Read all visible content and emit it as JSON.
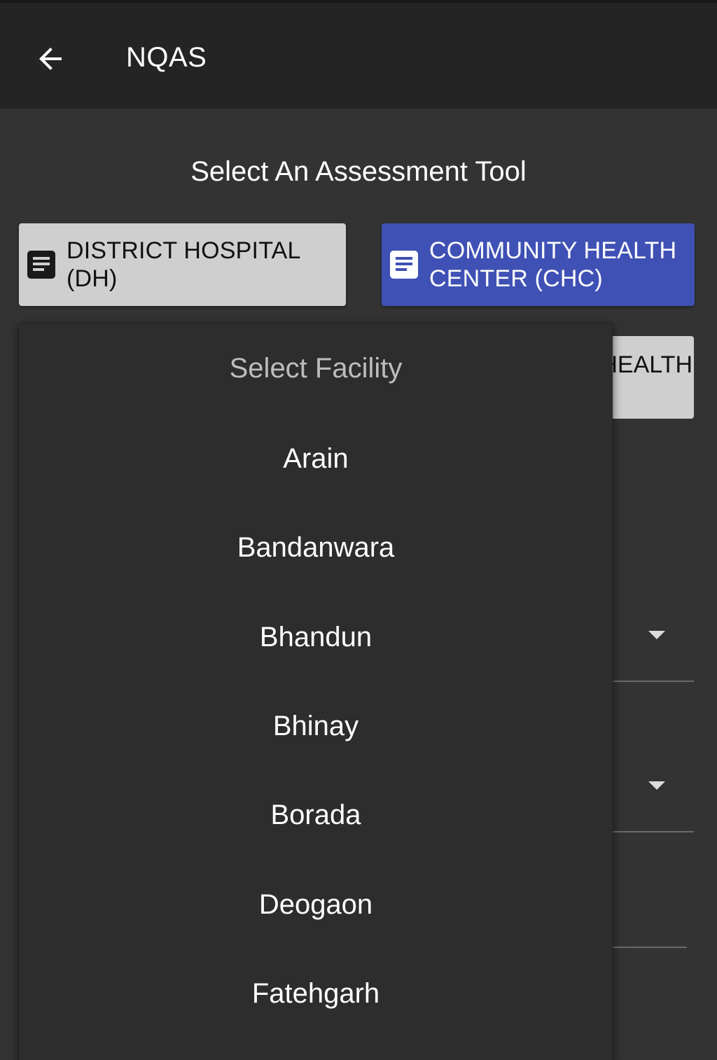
{
  "appbar": {
    "title": "NQAS",
    "back_icon": "arrow-left-icon"
  },
  "main": {
    "heading": "Select An Assessment Tool",
    "tools": [
      {
        "label": "DISTRICT HOSPITAL (DH)",
        "icon": "document-icon",
        "selected": false
      },
      {
        "label_line1": "COMMUNITY HEALTH",
        "label_line2": "CENTER (CHC)",
        "icon": "document-icon",
        "selected": true
      }
    ],
    "background_chip_text": "HEALTH"
  },
  "dropdown": {
    "header": "Select Facility",
    "options": [
      "Arain",
      "Bandanwara",
      "Bhandun",
      "Bhinay",
      "Borada",
      "Deogaon",
      "Fatehgarh"
    ]
  },
  "colors": {
    "appbar": "#242424",
    "background": "#333333",
    "accent": "#3f51b5",
    "secondary_button": "#cfcfcf",
    "popup": "#2d2d2d"
  }
}
